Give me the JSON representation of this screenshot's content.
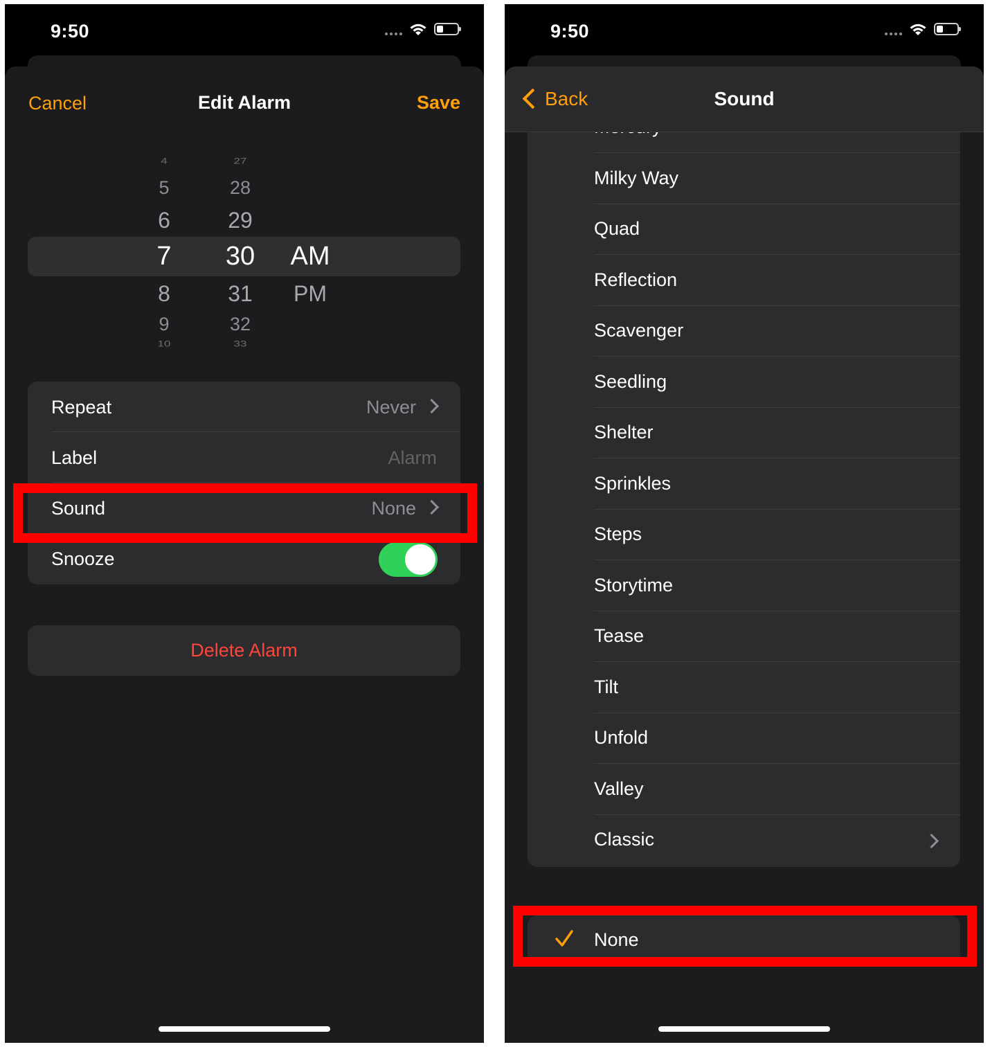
{
  "status_time": "9:50",
  "left": {
    "nav": {
      "cancel": "Cancel",
      "title": "Edit Alarm",
      "save": "Save"
    },
    "picker": {
      "hours": [
        "4",
        "5",
        "6",
        "7",
        "8",
        "9",
        "10"
      ],
      "minutes": [
        "27",
        "28",
        "29",
        "30",
        "31",
        "32",
        "33"
      ],
      "ampm": [
        "AM",
        "PM"
      ],
      "selected": {
        "hour": "7",
        "minute": "30",
        "ampm": "AM"
      }
    },
    "rows": {
      "repeat": {
        "label": "Repeat",
        "value": "Never"
      },
      "label": {
        "label": "Label",
        "placeholder": "Alarm"
      },
      "sound": {
        "label": "Sound",
        "value": "None"
      },
      "snooze": {
        "label": "Snooze",
        "on": true
      }
    },
    "delete": "Delete Alarm"
  },
  "right": {
    "nav": {
      "back": "Back",
      "title": "Sound"
    },
    "partial_item": "Mercury",
    "items": [
      "Milky Way",
      "Quad",
      "Reflection",
      "Scavenger",
      "Seedling",
      "Shelter",
      "Sprinkles",
      "Steps",
      "Storytime",
      "Tease",
      "Tilt",
      "Unfold",
      "Valley",
      "Classic"
    ],
    "none_option": "None"
  },
  "colors": {
    "accent": "#ff9f0a",
    "destructive": "#ff453a",
    "toggle_on": "#30d158",
    "highlight_box": "#fe0000"
  },
  "icons": [
    "wifi-icon",
    "battery-icon",
    "chevron-right-icon",
    "chevron-left-icon",
    "checkmark-icon"
  ]
}
